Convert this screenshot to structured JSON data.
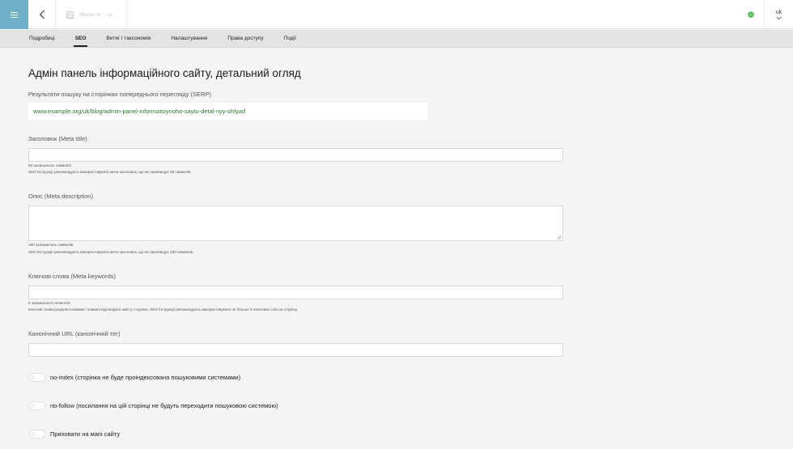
{
  "header": {
    "menu_icon": "hamburger-icon",
    "back_icon": "chevron-left-icon",
    "save_label": "Зберегти",
    "save_icon": "floppy-disk-icon",
    "status_color": "#6cc46a",
    "language": "uk"
  },
  "tabs": [
    {
      "label": "Подробиці",
      "active": false
    },
    {
      "label": "SEO",
      "active": true
    },
    {
      "label": "Витяг і таксономія",
      "active": false
    },
    {
      "label": "Налаштування",
      "active": false
    },
    {
      "label": "Права доступу",
      "active": false
    },
    {
      "label": "Події",
      "active": false
    }
  ],
  "main": {
    "title": "Адмін панель інформаційного сайту, детальний огляд",
    "serp_label": "Результати пошуку на сторінках попереднього перегляду (SERP)",
    "serp_url": "www.example.org/uk/blog/admin-panel-informatsiynoho-saytu-detal-nyy-ohlyad",
    "meta_title": {
      "label": "Заголовок (Meta title)",
      "value": "",
      "remaining": "55 залишилось символів",
      "hint": "SEO інструкції рекомендують використовувати мета-заголовок, що не перевищує 55 символів."
    },
    "meta_description": {
      "label": "Опис (Meta description)",
      "value": "",
      "remaining": "160 залишилось символів",
      "hint": "SEO інструкції рекомендують використовувати мета-заголовок, що не перевищує 160 символів."
    },
    "meta_keywords": {
      "label": "Ключові слова (Meta keywords)",
      "value": "",
      "remaining": "5 залишилося сегментів",
      "hint": "Ключові слова розділені комами і повинні відповідати змісту сторінки. SEO інструкції рекомендують використовувати не більше 5 ключових слів на сторінці."
    },
    "canonical": {
      "label": "Канонічний URL (канонічний тег)",
      "value": ""
    },
    "toggles": [
      {
        "label": "no-index (сторінка не буде проіндексована пошуковими системами)",
        "on": false
      },
      {
        "label": "no-follow (посилання на цій сторінці не будуть переходити пошуковою системою)",
        "on": false
      },
      {
        "label": "Приховати на мапі сайту",
        "on": false
      }
    ]
  },
  "colors": {
    "accent": "#6fb0c8",
    "url_green": "#2b7a30"
  }
}
